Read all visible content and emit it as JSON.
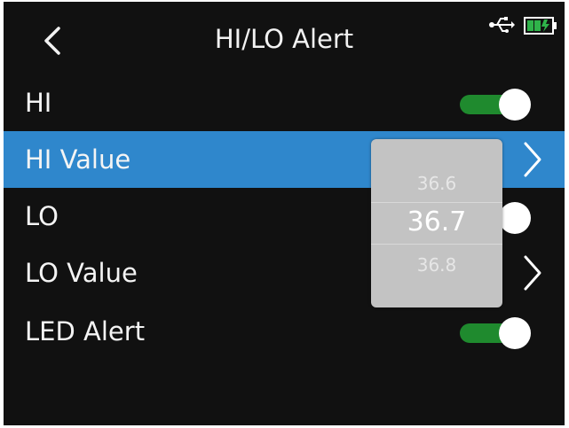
{
  "header": {
    "title": "HI/LO Alert",
    "back_icon": "back-arrow-icon",
    "status_icons": [
      "usb-icon",
      "battery-icon"
    ],
    "battery_color": "#2fb34a"
  },
  "rows": [
    {
      "label": "HI",
      "control": "toggle",
      "on": true
    },
    {
      "label": "HI Value",
      "control": "chevron",
      "selected": true
    },
    {
      "label": "LO",
      "control": "toggle",
      "on": true
    },
    {
      "label": "LO Value",
      "control": "chevron"
    },
    {
      "label": "LED Alert",
      "control": "toggle",
      "on": true
    }
  ],
  "picker": {
    "prev": "36.6",
    "current": "36.7",
    "next": "36.8"
  },
  "colors": {
    "selected_row": "#2f87cc",
    "toggle_on": "#1f8a2e",
    "background": "#111111"
  }
}
